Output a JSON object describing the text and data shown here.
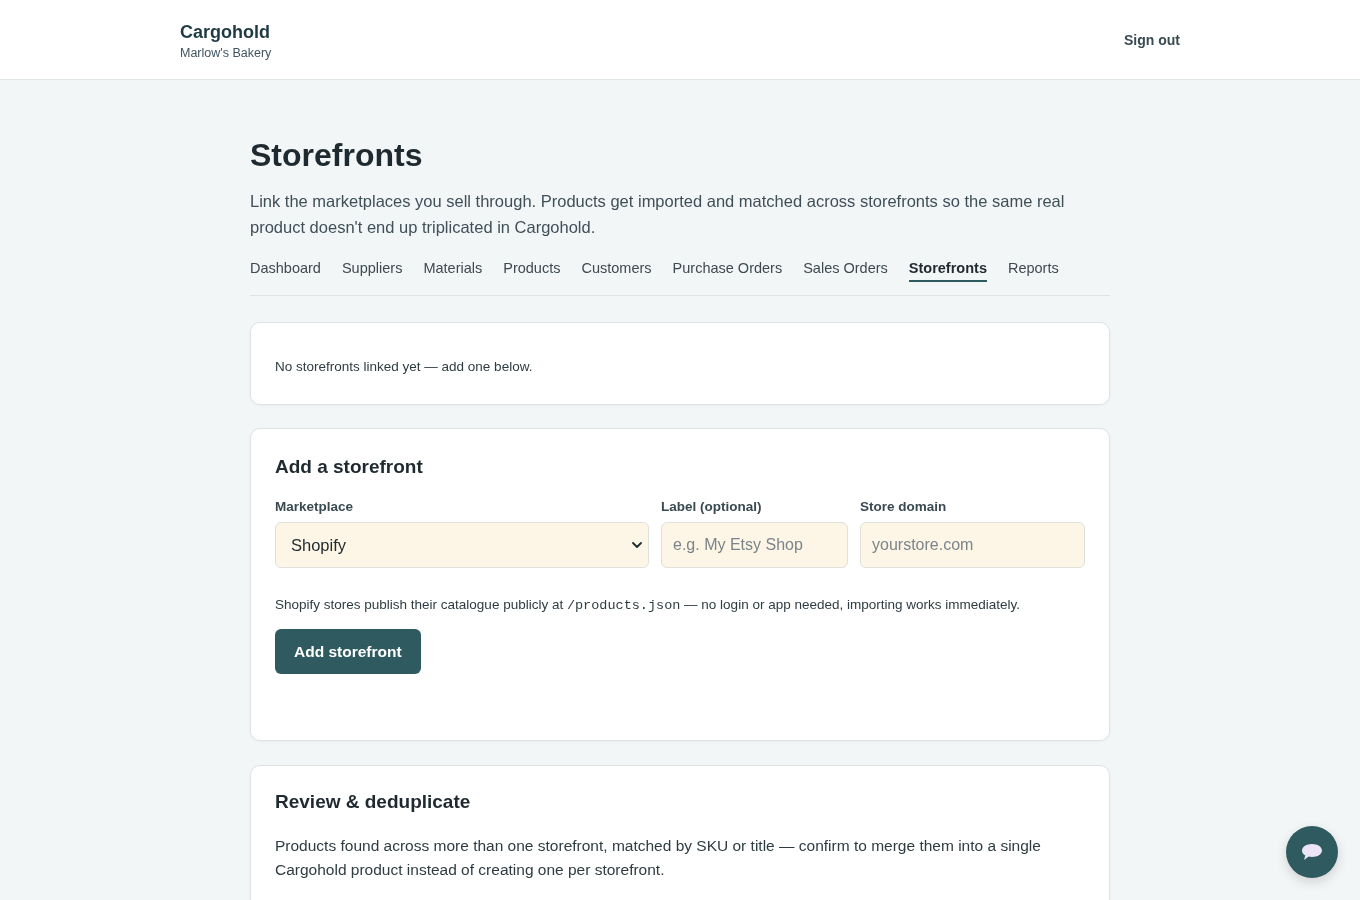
{
  "header": {
    "brand": "Cargohold",
    "subtitle": "Marlow's Bakery",
    "sign_out": "Sign out"
  },
  "page": {
    "title": "Storefronts",
    "description": "Link the marketplaces you sell through. Products get imported and matched across storefronts so the same real product doesn't end up triplicated in Cargohold."
  },
  "tabs": [
    {
      "label": "Dashboard",
      "selected": false
    },
    {
      "label": "Suppliers",
      "selected": false
    },
    {
      "label": "Materials",
      "selected": false
    },
    {
      "label": "Products",
      "selected": false
    },
    {
      "label": "Customers",
      "selected": false
    },
    {
      "label": "Purchase Orders",
      "selected": false
    },
    {
      "label": "Sales Orders",
      "selected": false
    },
    {
      "label": "Storefronts",
      "selected": true
    },
    {
      "label": "Reports",
      "selected": false
    }
  ],
  "empty_notice": "No storefronts linked yet — add one below.",
  "add_form": {
    "title": "Add a storefront",
    "fields": [
      {
        "kind": "select",
        "label": "Marketplace",
        "value": "Shopify"
      },
      {
        "kind": "text",
        "label": "Label (optional)",
        "placeholder": "e.g. My Etsy Shop"
      },
      {
        "kind": "text",
        "label": "Store domain",
        "placeholder": "yourstore.com"
      }
    ],
    "help": [
      {
        "kind": "text",
        "text": "Shopify stores publish their catalogue publicly at "
      },
      {
        "kind": "code",
        "text": "/products.json"
      },
      {
        "kind": "text",
        "text": " — no login or app needed, importing works immediately."
      }
    ],
    "submit": "Add storefront"
  },
  "review": {
    "title": "Review & deduplicate",
    "description": "Products found across more than one storefront, matched by SKU or title — confirm to merge them into a single Cargohold product instead of creating one per storefront."
  }
}
